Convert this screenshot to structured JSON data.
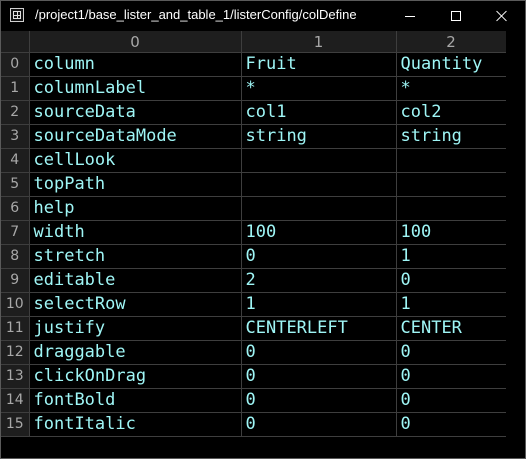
{
  "window": {
    "title": "/project1/base_lister_and_table_1/listerConfig/colDefine",
    "icon": "table-app-icon",
    "controls": [
      "minimize-icon",
      "maximize-icon",
      "close-icon"
    ]
  },
  "table": {
    "column_headers": [
      "0",
      "1",
      "2"
    ],
    "rows": [
      {
        "index": "0",
        "cells": [
          "column",
          "Fruit",
          "Quantity"
        ]
      },
      {
        "index": "1",
        "cells": [
          "columnLabel",
          "*",
          "*"
        ]
      },
      {
        "index": "2",
        "cells": [
          "sourceData",
          "col1",
          "col2"
        ]
      },
      {
        "index": "3",
        "cells": [
          "sourceDataMode",
          "string",
          "string"
        ]
      },
      {
        "index": "4",
        "cells": [
          "cellLook",
          "",
          ""
        ]
      },
      {
        "index": "5",
        "cells": [
          "topPath",
          "",
          ""
        ]
      },
      {
        "index": "6",
        "cells": [
          "help",
          "",
          ""
        ]
      },
      {
        "index": "7",
        "cells": [
          "width",
          "100",
          "100"
        ]
      },
      {
        "index": "8",
        "cells": [
          "stretch",
          "0",
          "1"
        ]
      },
      {
        "index": "9",
        "cells": [
          "editable",
          "2",
          "0"
        ]
      },
      {
        "index": "10",
        "cells": [
          "selectRow",
          "1",
          "1"
        ]
      },
      {
        "index": "11",
        "cells": [
          "justify",
          "CENTERLEFT",
          "CENTER"
        ]
      },
      {
        "index": "12",
        "cells": [
          "draggable",
          "0",
          "0"
        ]
      },
      {
        "index": "13",
        "cells": [
          "clickOnDrag",
          "0",
          "0"
        ]
      },
      {
        "index": "14",
        "cells": [
          "fontBold",
          "0",
          "0"
        ]
      },
      {
        "index": "15",
        "cells": [
          "fontItalic",
          "0",
          "0"
        ]
      }
    ]
  },
  "colors": {
    "background": "#000000",
    "cell_text": "#9ff6f6",
    "header_bg": "#1e1e1e",
    "header_text": "#a8a8a8",
    "grid_line": "#3e3e3e"
  }
}
